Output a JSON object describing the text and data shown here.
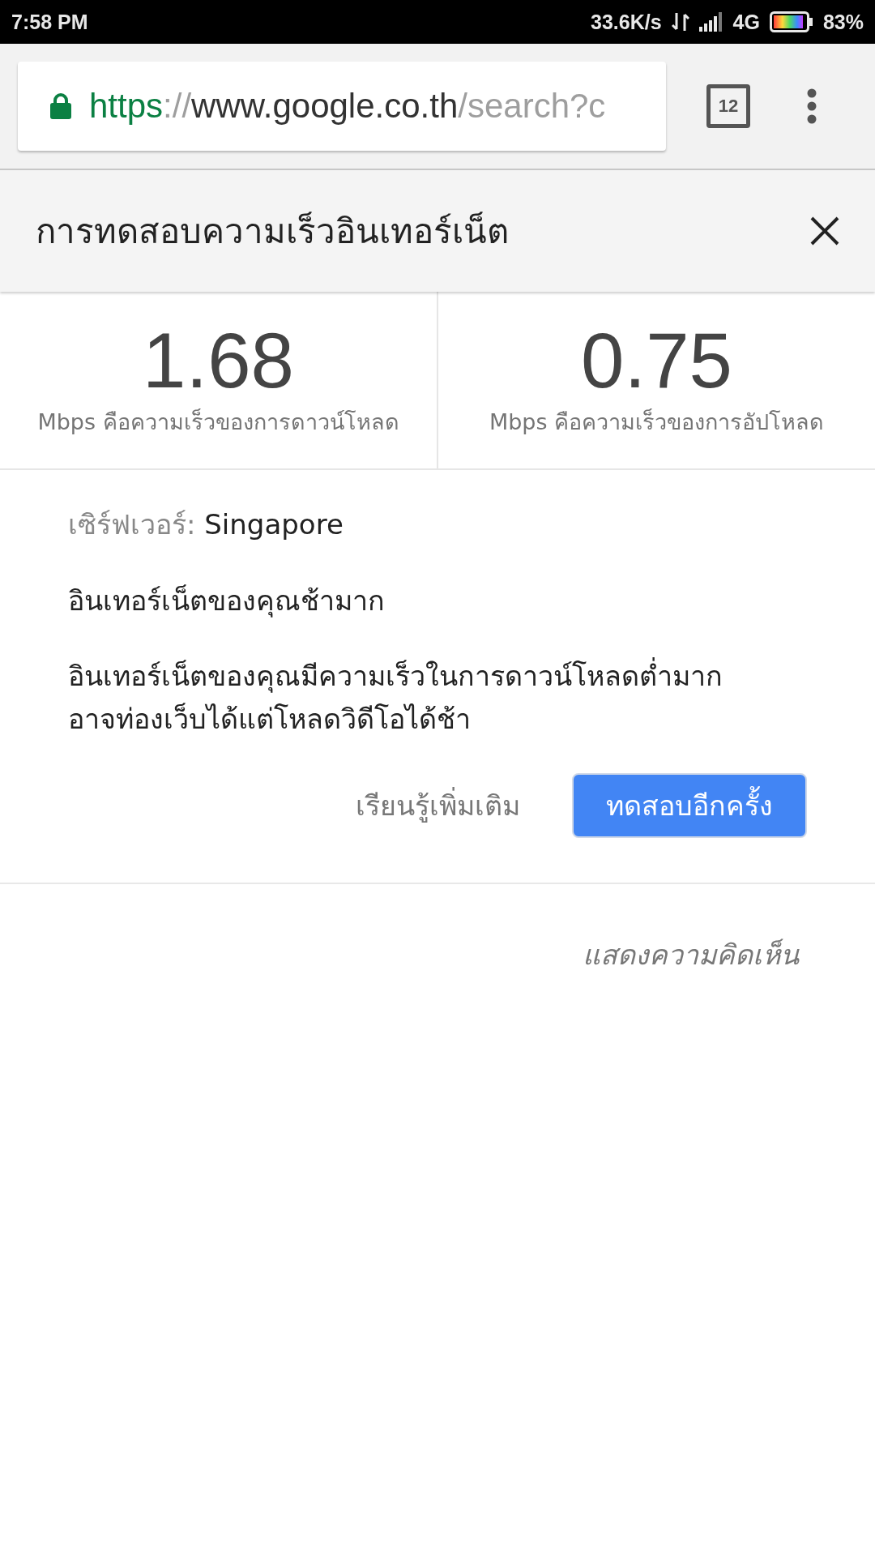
{
  "status_bar": {
    "time": "7:58 PM",
    "speed": "33.6K/s",
    "network": "4G",
    "battery": "83%"
  },
  "toolbar": {
    "url_parts": [
      {
        "kind": "scheme",
        "text": "https"
      },
      {
        "kind": "separator",
        "text": "://"
      },
      {
        "kind": "host",
        "text": "www.google.co.th"
      },
      {
        "kind": "path",
        "text": "/search?c"
      }
    ],
    "tab_count": "12"
  },
  "card": {
    "title": "การทดสอบความเร็วอินเทอร์เน็ต",
    "results": [
      {
        "value": "1.68",
        "caption": "Mbps คือความเร็วของการดาวน์โหลด"
      },
      {
        "value": "0.75",
        "caption": "Mbps คือความเร็วของการอัปโหลด"
      }
    ],
    "server_label": "เซิร์ฟเวอร์:",
    "server": "Singapore",
    "verdict": "อินเทอร์เน็ตของคุณช้ามาก",
    "details": [
      "อินเทอร์เน็ตของคุณมีความเร็วในการดาวน์โหลดต่ำมาก",
      "อาจท่องเว็บได้แต่โหลดวิดีโอได้ช้า"
    ],
    "buttons": [
      {
        "kind": "link",
        "label": "เรียนรู้เพิ่มเติม"
      },
      {
        "kind": "primary",
        "label": "ทดสอบอีกครั้ง"
      }
    ],
    "feedback": "แสดงความคิดเห็น"
  }
}
